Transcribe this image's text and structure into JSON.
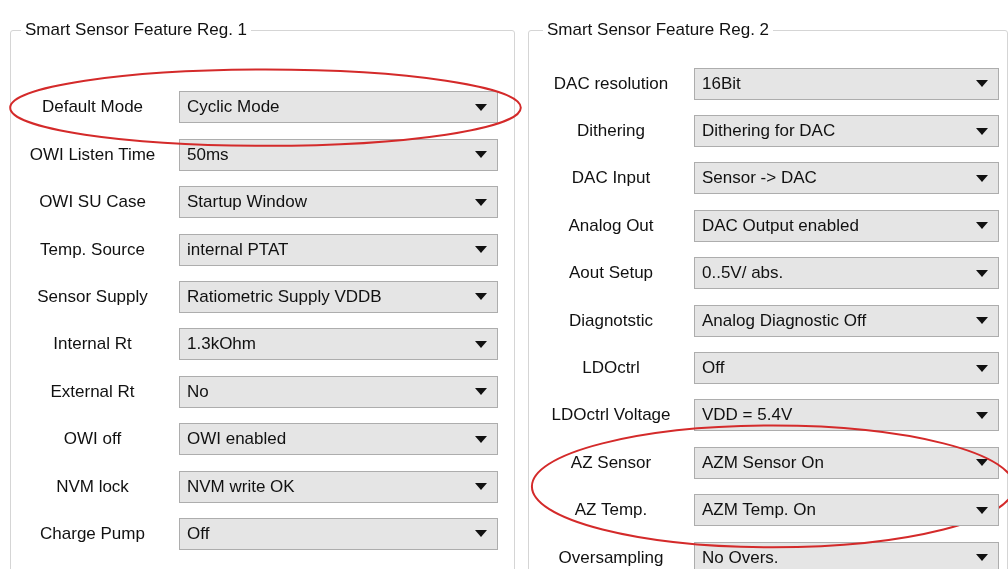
{
  "groups": [
    {
      "title": "Smart Sensor Feature Reg. 1",
      "rows": [
        {
          "label": "Default Mode",
          "value": "Cyclic Mode",
          "circled": true
        },
        {
          "label": "OWI Listen Time",
          "value": "50ms",
          "circled": false
        },
        {
          "label": "OWI SU Case",
          "value": "Startup Window",
          "circled": false
        },
        {
          "label": "Temp. Source",
          "value": "internal PTAT",
          "circled": false
        },
        {
          "label": "Sensor Supply",
          "value": "Ratiometric Supply VDDB",
          "circled": false
        },
        {
          "label": "Internal Rt",
          "value": "1.3kOhm",
          "circled": false
        },
        {
          "label": "External Rt",
          "value": "No",
          "circled": false
        },
        {
          "label": "OWI off",
          "value": "OWI enabled",
          "circled": false
        },
        {
          "label": "NVM lock",
          "value": "NVM write OK",
          "circled": false
        },
        {
          "label": "Charge Pump",
          "value": "Off",
          "circled": false
        }
      ]
    },
    {
      "title": "Smart Sensor Feature Reg. 2",
      "rows": [
        {
          "label": "DAC resolution",
          "value": "16Bit",
          "circled": false
        },
        {
          "label": "Dithering",
          "value": "Dithering for DAC",
          "circled": false
        },
        {
          "label": "DAC Input",
          "value": "Sensor -> DAC",
          "circled": false
        },
        {
          "label": "Analog Out",
          "value": "DAC Output enabled",
          "circled": false
        },
        {
          "label": "Aout Setup",
          "value": "0..5V/ abs.",
          "circled": false
        },
        {
          "label": "Diagnotstic",
          "value": "Analog Diagnostic Off",
          "circled": false
        },
        {
          "label": "LDOctrl",
          "value": "Off",
          "circled": false
        },
        {
          "label": "LDOctrl Voltage",
          "value": "VDD = 5.4V",
          "circled": false
        },
        {
          "label": "AZ Sensor",
          "value": "AZM Sensor On",
          "circled": true
        },
        {
          "label": "AZ Temp.",
          "value": "AZM Temp. On",
          "circled": true
        },
        {
          "label": "Oversampling",
          "value": "No Overs.",
          "circled": false
        }
      ]
    }
  ]
}
